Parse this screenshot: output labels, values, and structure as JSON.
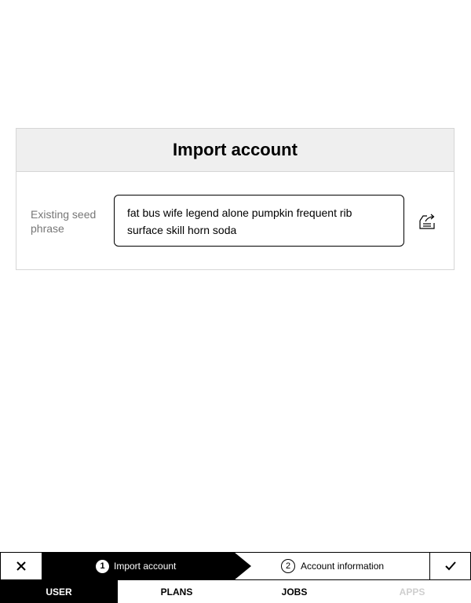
{
  "card": {
    "title": "Import account",
    "field_label": "Existing seed phrase",
    "seed_phrase": "fat bus wife legend alone pumpkin frequent rib surface skill horn soda",
    "import_icon": "import-file-icon"
  },
  "stepper": {
    "close_icon": "close-icon",
    "confirm_icon": "checkmark-icon",
    "steps": [
      {
        "number": "1",
        "label": "Import account",
        "state": "active"
      },
      {
        "number": "2",
        "label": "Account information",
        "state": "pending"
      }
    ]
  },
  "tabs": [
    {
      "label": "USER",
      "state": "active"
    },
    {
      "label": "PLANS",
      "state": "normal"
    },
    {
      "label": "JOBS",
      "state": "normal"
    },
    {
      "label": "APPS",
      "state": "disabled"
    }
  ]
}
